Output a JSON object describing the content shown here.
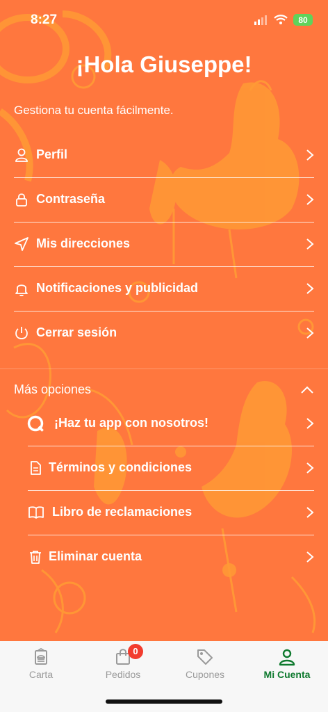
{
  "status": {
    "time": "8:27",
    "battery": "80"
  },
  "header": {
    "greeting": "¡Hola Giuseppe!",
    "subtitle": "Gestiona tu cuenta fácilmente."
  },
  "menu": [
    {
      "label": "Perfil",
      "icon": "user-icon"
    },
    {
      "label": "Contraseña",
      "icon": "lock-icon"
    },
    {
      "label": "Mis direcciones",
      "icon": "location-arrow-icon"
    },
    {
      "label": "Notificaciones y publicidad",
      "icon": "bell-icon"
    },
    {
      "label": "Cerrar sesión",
      "icon": "power-icon"
    }
  ],
  "more": {
    "title": "Más opciones",
    "items": [
      {
        "label": "¡Haz tu app con nosotros!",
        "icon": "app-logo-icon"
      },
      {
        "label": "Términos y condiciones",
        "icon": "document-icon"
      },
      {
        "label": "Libro de reclamaciones",
        "icon": "book-icon"
      },
      {
        "label": "Eliminar cuenta",
        "icon": "trash-icon"
      }
    ]
  },
  "tabs": [
    {
      "label": "Carta",
      "icon": "menu-card-icon"
    },
    {
      "label": "Pedidos",
      "icon": "shopping-bag-icon",
      "badge": "0"
    },
    {
      "label": "Cupones",
      "icon": "tag-icon"
    },
    {
      "label": "Mi Cuenta",
      "icon": "account-icon"
    }
  ],
  "colors": {
    "background": "#FF773E",
    "accent": "#0F7A2F",
    "badge": "#F23C2E",
    "tabbar": "#F7F7F7"
  }
}
